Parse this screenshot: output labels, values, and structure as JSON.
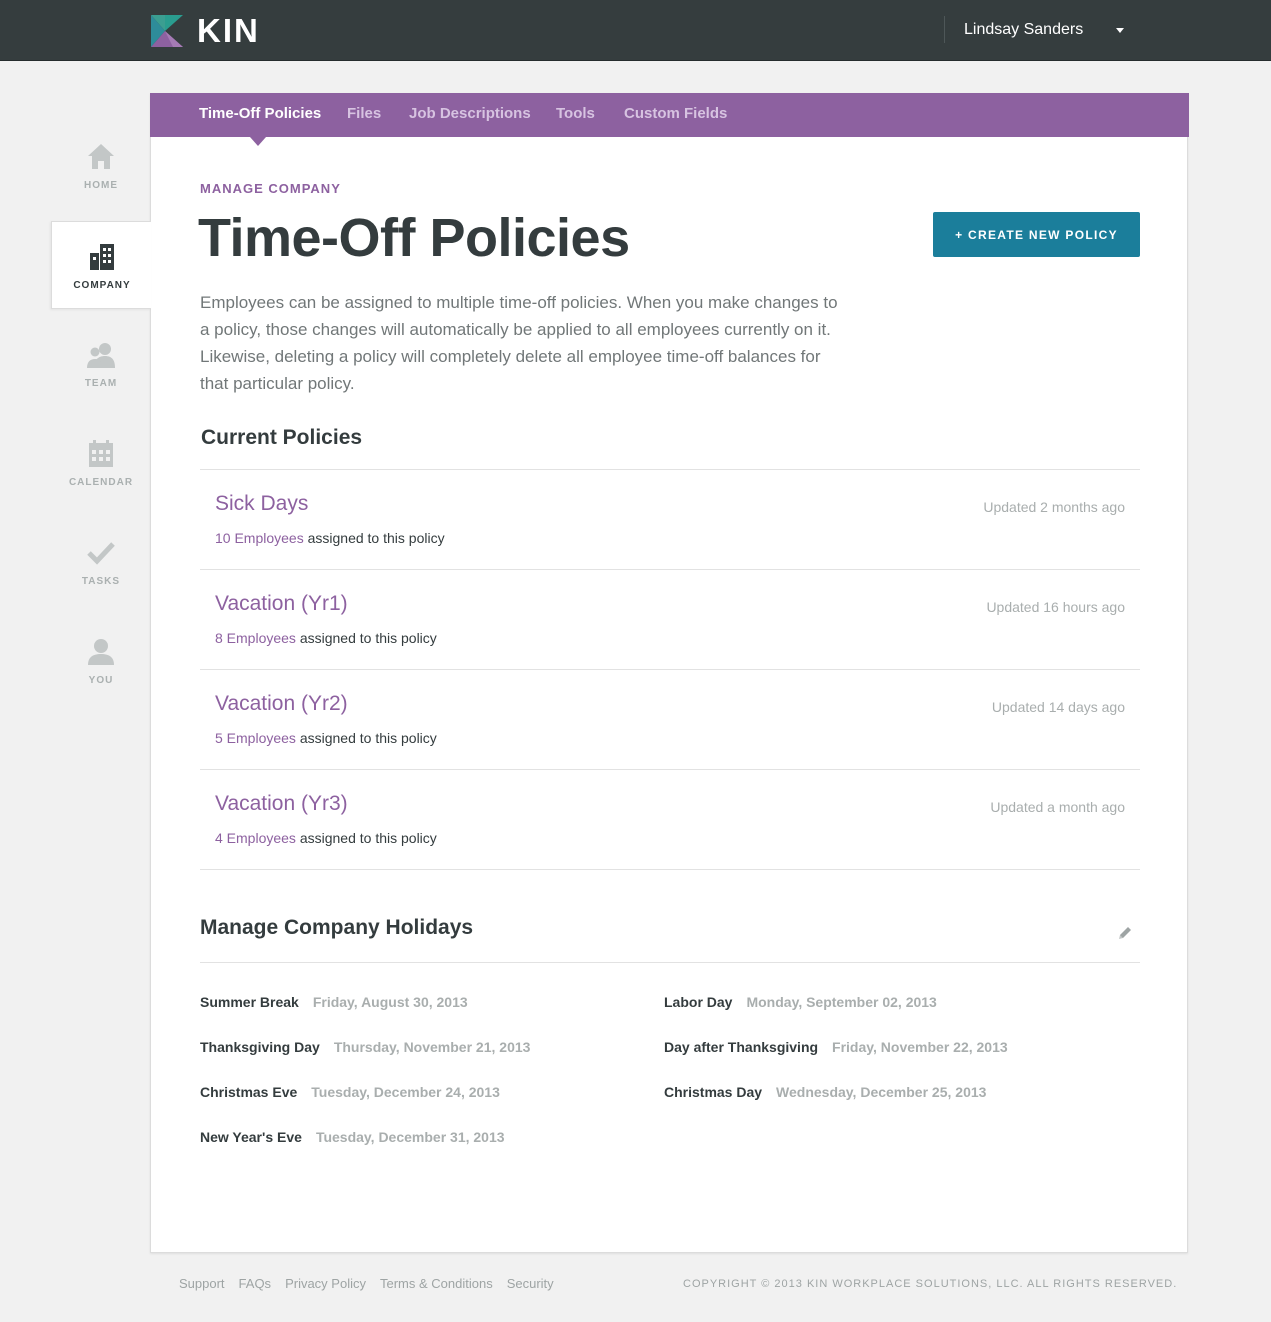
{
  "header": {
    "logo_text": "KIN",
    "user_name": "Lindsay Sanders"
  },
  "side_nav": [
    {
      "label": "HOME",
      "icon": "home-icon"
    },
    {
      "label": "COMPANY",
      "icon": "building-icon",
      "active": true
    },
    {
      "label": "TEAM",
      "icon": "team-icon"
    },
    {
      "label": "CALENDAR",
      "icon": "calendar-icon"
    },
    {
      "label": "TASKS",
      "icon": "checkmark-icon"
    },
    {
      "label": "YOU",
      "icon": "person-icon"
    }
  ],
  "tabs": [
    {
      "label": "Time-Off Policies",
      "active": true
    },
    {
      "label": "Files"
    },
    {
      "label": "Job Descriptions"
    },
    {
      "label": "Tools"
    },
    {
      "label": "Custom Fields"
    }
  ],
  "page": {
    "eyebrow": "MANAGE COMPANY",
    "title": "Time-Off Policies",
    "create_button": "+ CREATE NEW POLICY",
    "intro": "Employees can be assigned to multiple time-off policies. When you make changes to a policy, those changes will automatically be applied to all employees currently on it. Likewise, deleting a policy will completely delete all employee time-off balances for that particular policy."
  },
  "current_policies": {
    "title": "Current Policies",
    "assigned_suffix": " assigned to this policy",
    "items": [
      {
        "name": "Sick Days",
        "employees": "10 Employees",
        "updated": "Updated 2 months ago"
      },
      {
        "name": "Vacation (Yr1)",
        "employees": "8 Employees",
        "updated": "Updated 16 hours ago"
      },
      {
        "name": "Vacation (Yr2)",
        "employees": "5 Employees",
        "updated": "Updated 14 days ago"
      },
      {
        "name": "Vacation (Yr3)",
        "employees": "4 Employees",
        "updated": "Updated a month ago"
      }
    ]
  },
  "holidays": {
    "title": "Manage Company Holidays",
    "items": [
      {
        "name": "Summer Break",
        "date": "Friday, August 30, 2013"
      },
      {
        "name": "Labor Day",
        "date": "Monday, September 02, 2013"
      },
      {
        "name": "Thanksgiving Day",
        "date": "Thursday, November 21, 2013"
      },
      {
        "name": "Day after Thanksgiving",
        "date": "Friday, November 22, 2013"
      },
      {
        "name": "Christmas Eve",
        "date": "Tuesday, December 24, 2013"
      },
      {
        "name": "Christmas Day",
        "date": "Wednesday, December 25, 2013"
      },
      {
        "name": "New Year's Eve",
        "date": "Tuesday, December 31, 2013"
      }
    ]
  },
  "footer": {
    "links": [
      "Support",
      "FAQs",
      "Privacy Policy",
      "Terms & Conditions",
      "Security"
    ],
    "copyright": "COPYRIGHT © 2013 KIN WORKPLACE SOLUTIONS, LLC. ALL RIGHTS RESERVED."
  },
  "colors": {
    "topbar": "#353d3e",
    "accent_purple": "#8d61a0",
    "button_blue": "#1b7e9b",
    "text_dark": "#343c3e",
    "text_muted": "#a9aeae"
  }
}
